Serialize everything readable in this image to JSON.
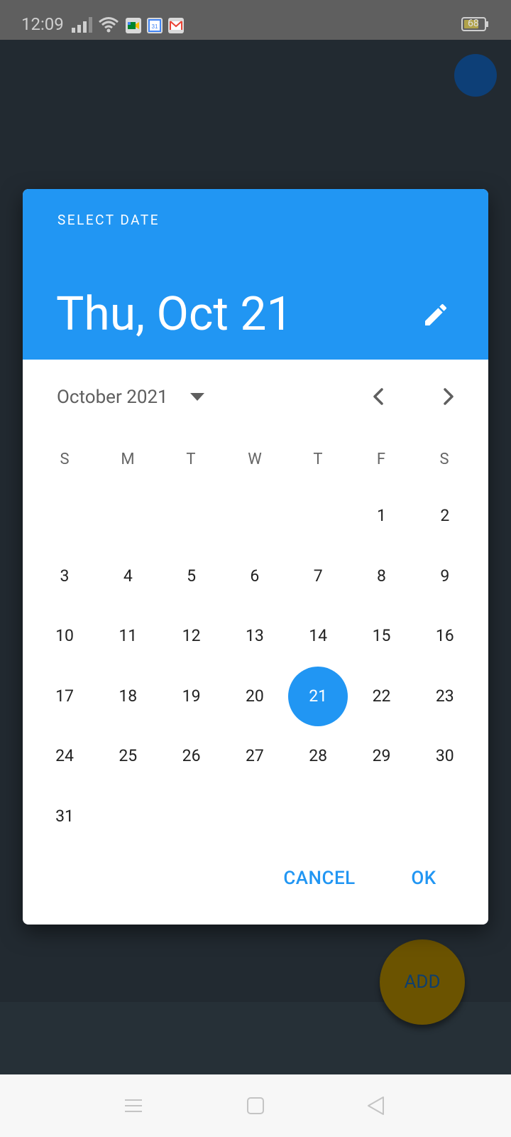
{
  "status_bar": {
    "time": "12:09",
    "battery": "68",
    "notification_icons": [
      "meet-icon",
      "calendar-icon",
      "gmail-icon"
    ]
  },
  "dialog": {
    "header_label": "SELECT DATE",
    "selected_date": "Thu, Oct 21",
    "month_year": "October 2021",
    "weekdays": [
      "S",
      "M",
      "T",
      "W",
      "T",
      "F",
      "S"
    ],
    "first_weekday_index": 5,
    "days_in_month": 31,
    "selected_day": 21,
    "cancel_label": "CANCEL",
    "ok_label": "OK",
    "accent_color": "#2196f3"
  },
  "background": {
    "fab_label": "ADD"
  }
}
